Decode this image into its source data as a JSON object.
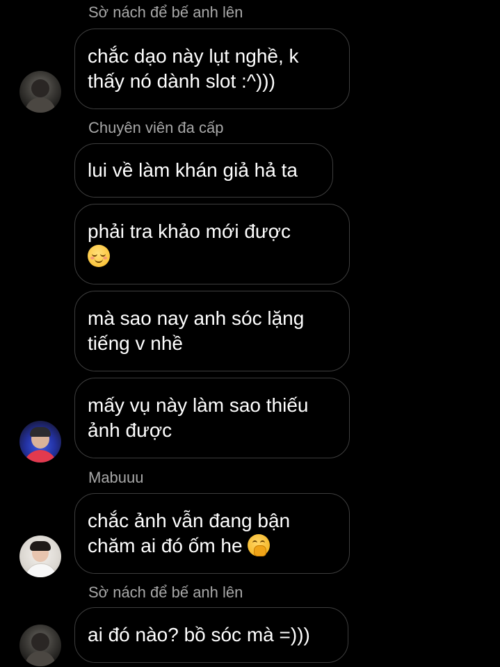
{
  "messages": [
    {
      "sender": "Sờ nách để bế anh lên"
    },
    {
      "text": "chắc dạo này lụt nghề, k\nthấy nó dành slot :^)))"
    },
    {
      "sender": "Chuyên viên đa cấp"
    },
    {
      "text": "lui về làm khán giả hả ta"
    },
    {
      "text": "phải tra khảo mới được",
      "emoji": "relieved-face-emoji"
    },
    {
      "text": "mà sao nay anh sóc lặng\ntiếng v nhề"
    },
    {
      "text": "mấy vụ này làm sao thiếu\nảnh được"
    },
    {
      "sender": "Mabuuu"
    },
    {
      "text": "chắc ảnh vẫn đang bận\nchăm ai đó ốm he",
      "emoji": "face-with-hand-over-mouth-emoji"
    },
    {
      "sender": "Sờ nách để bế anh lên"
    },
    {
      "text": "ai đó nào? bồ sóc mà =)))"
    }
  ],
  "avatars": [
    {
      "name": "avatar-so-nach",
      "style": "dark"
    },
    {
      "name": "avatar-chuyen-vien",
      "style": "blue"
    },
    {
      "name": "avatar-mabuuu",
      "style": "light"
    },
    {
      "name": "avatar-so-nach",
      "style": "dark"
    }
  ],
  "colors": {
    "background": "#000000",
    "bubble_border": "#3e3e3e",
    "message_text": "#ffffff",
    "sender_text": "#a8a8a8"
  }
}
